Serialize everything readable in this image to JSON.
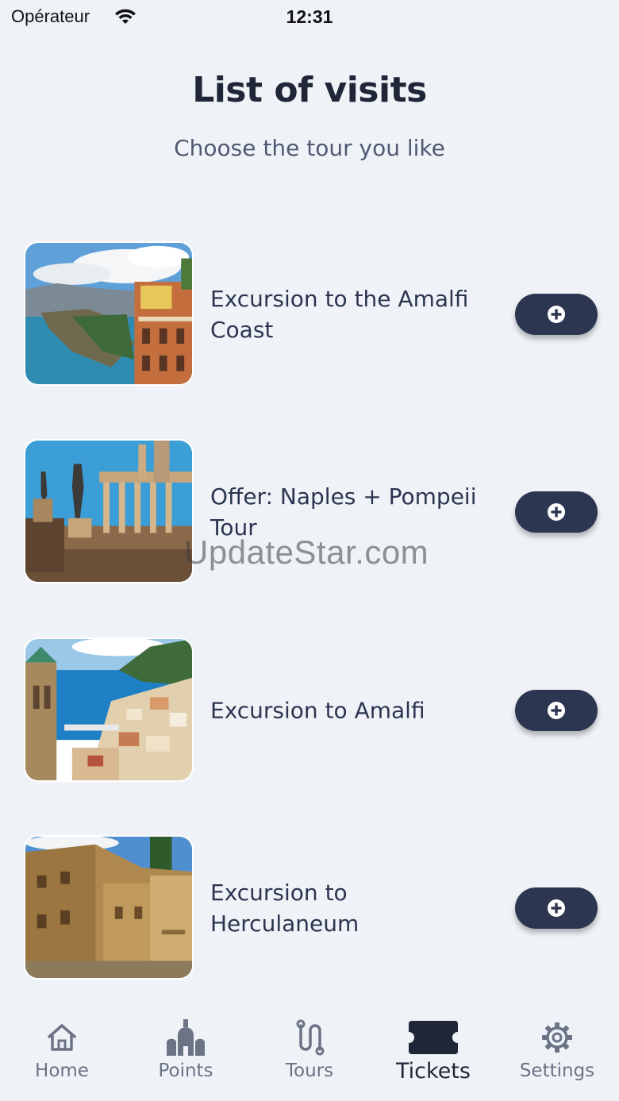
{
  "status_bar": {
    "carrier": "Opérateur",
    "time": "12:31"
  },
  "header": {
    "title": "List of visits",
    "subtitle": "Choose the tour you like"
  },
  "tours": [
    {
      "name": "Excursion to the Amalfi Coast",
      "image": "amalfi-coast-photo"
    },
    {
      "name": "Offer: Naples + Pompeii Tour",
      "image": "pompeii-ruins-photo"
    },
    {
      "name": "Excursion to Amalfi",
      "image": "amalfi-town-photo"
    },
    {
      "name": "Excursion to Herculaneum",
      "image": "herculaneum-ruins-photo"
    }
  ],
  "watermark": "UpdateStar.com",
  "tab_bar": {
    "items": [
      {
        "label": "Home",
        "icon": "home-icon"
      },
      {
        "label": "Points",
        "icon": "church-icon"
      },
      {
        "label": "Tours",
        "icon": "route-icon"
      },
      {
        "label": "Tickets",
        "icon": "ticket-icon",
        "active": true
      },
      {
        "label": "Settings",
        "icon": "gear-icon"
      }
    ]
  },
  "colors": {
    "background": "#eff3f8",
    "button": "#2d3650",
    "title": "#1f2637",
    "subtitle": "#4f5a72",
    "inactive_tab": "#6b7385"
  }
}
